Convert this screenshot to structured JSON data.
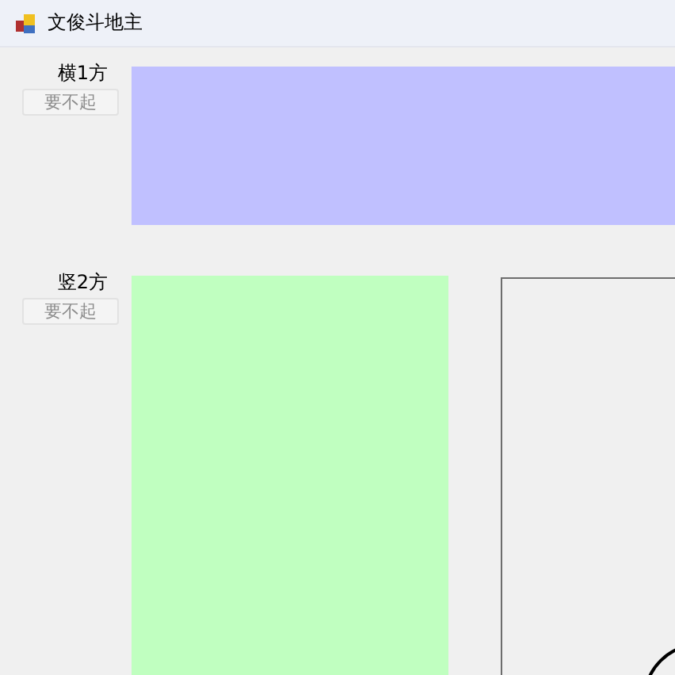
{
  "window": {
    "title": "文俊斗地主"
  },
  "players": [
    {
      "label": "横1方",
      "button": {
        "label": "要不起",
        "disabled": true
      },
      "color": "#c0c0ff",
      "kind": "horizontal"
    },
    {
      "label": "竖2方",
      "button": {
        "label": "要不起",
        "disabled": true
      },
      "color": "#c0ffc0",
      "kind": "vertical"
    }
  ]
}
